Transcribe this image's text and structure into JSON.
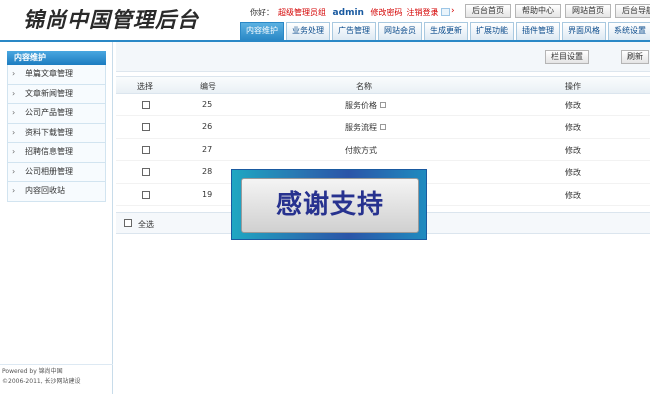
{
  "header": {
    "logo": "锦尚中国管理后台",
    "greeting": "你好：",
    "role": "超级管理员组",
    "username": "admin",
    "change_password": "修改密码",
    "logout": "注销登录",
    "top_buttons": [
      "后台首页",
      "帮助中心",
      "网站首页",
      "后台导航"
    ],
    "nav_tabs": [
      "内容维护",
      "业务处理",
      "广告管理",
      "网站会员",
      "生成更新",
      "扩展功能",
      "插件管理",
      "界面风格",
      "系统设置"
    ]
  },
  "sidebar": {
    "title": "内容维护",
    "items": [
      "单篇文章管理",
      "文章新闻管理",
      "公司产品管理",
      "资料下载管理",
      "招聘信息管理",
      "公司相册管理",
      "内容回收站"
    ],
    "footer_line1": "Powered by 锦尚中国",
    "footer_line2": "©2006-2011, 长沙网站建设"
  },
  "toolbar": {
    "column_settings": "栏目设置",
    "refresh": "刷新"
  },
  "table": {
    "headers": {
      "select": "选择",
      "id": "编号",
      "name": "名称",
      "action": "操作"
    },
    "rows": [
      {
        "id": "25",
        "name": "服务价格",
        "action": "修改"
      },
      {
        "id": "26",
        "name": "服务流程",
        "action": "修改"
      },
      {
        "id": "27",
        "name": "付款方式",
        "action": "修改"
      },
      {
        "id": "28",
        "name": "",
        "action": "修改"
      },
      {
        "id": "19",
        "name": "",
        "action": "修改"
      }
    ],
    "select_all": "全选"
  },
  "banner": {
    "text": "感谢支持"
  }
}
